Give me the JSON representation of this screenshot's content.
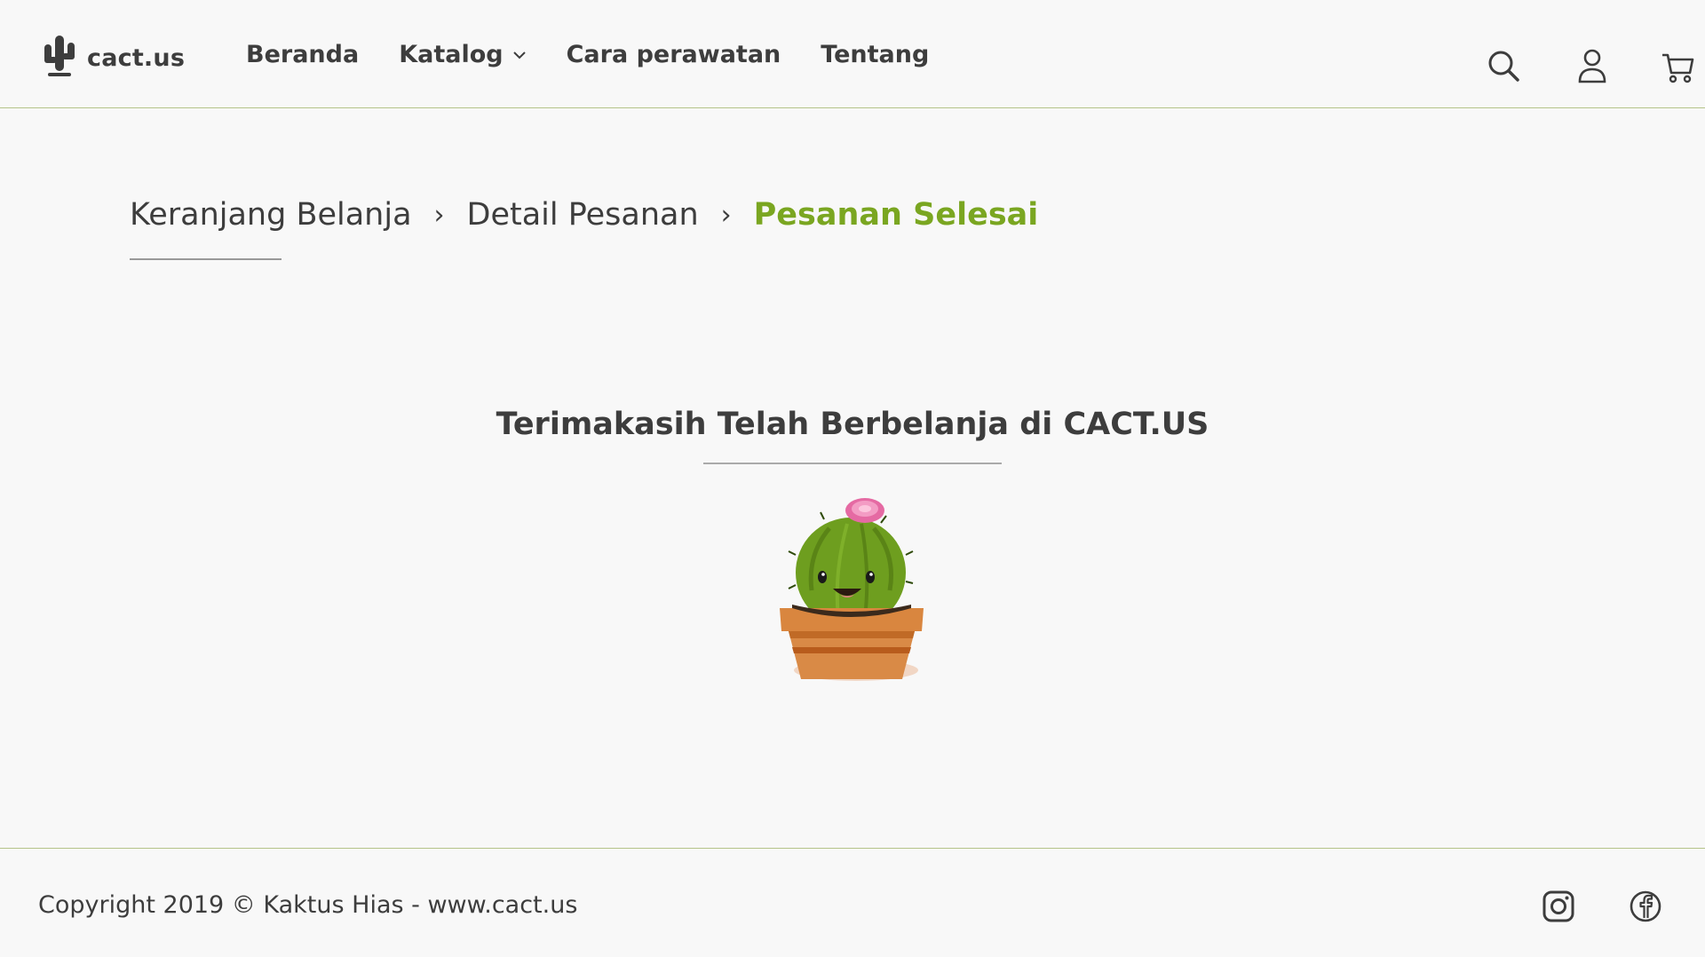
{
  "brand": {
    "name": "cact.us",
    "logo_icon": "cactus-logo-icon"
  },
  "nav": {
    "items": [
      {
        "label": "Beranda"
      },
      {
        "label": "Katalog",
        "has_dropdown": true
      },
      {
        "label": "Cara perawatan"
      },
      {
        "label": "Tentang"
      }
    ]
  },
  "header_icons": [
    "search-icon",
    "user-icon",
    "cart-icon"
  ],
  "breadcrumb": {
    "steps": [
      {
        "label": "Keranjang Belanja"
      },
      {
        "label": "Detail Pesanan"
      },
      {
        "label": "Pesanan Selesai",
        "active": true
      }
    ],
    "separator": "›"
  },
  "main": {
    "thanks_message": "Terimakasih Telah Berbelanja di CACT.US",
    "illustration": "cactus-pot-illustration"
  },
  "footer": {
    "copyright": "Copyright 2019 © Kaktus Hias - www.cact.us",
    "social_icons": [
      "instagram-icon",
      "facebook-icon"
    ]
  },
  "colors": {
    "accent": "#7aa621",
    "text": "#3d3d3d",
    "divider": "#b5c48a",
    "background": "#f8f8f8"
  }
}
